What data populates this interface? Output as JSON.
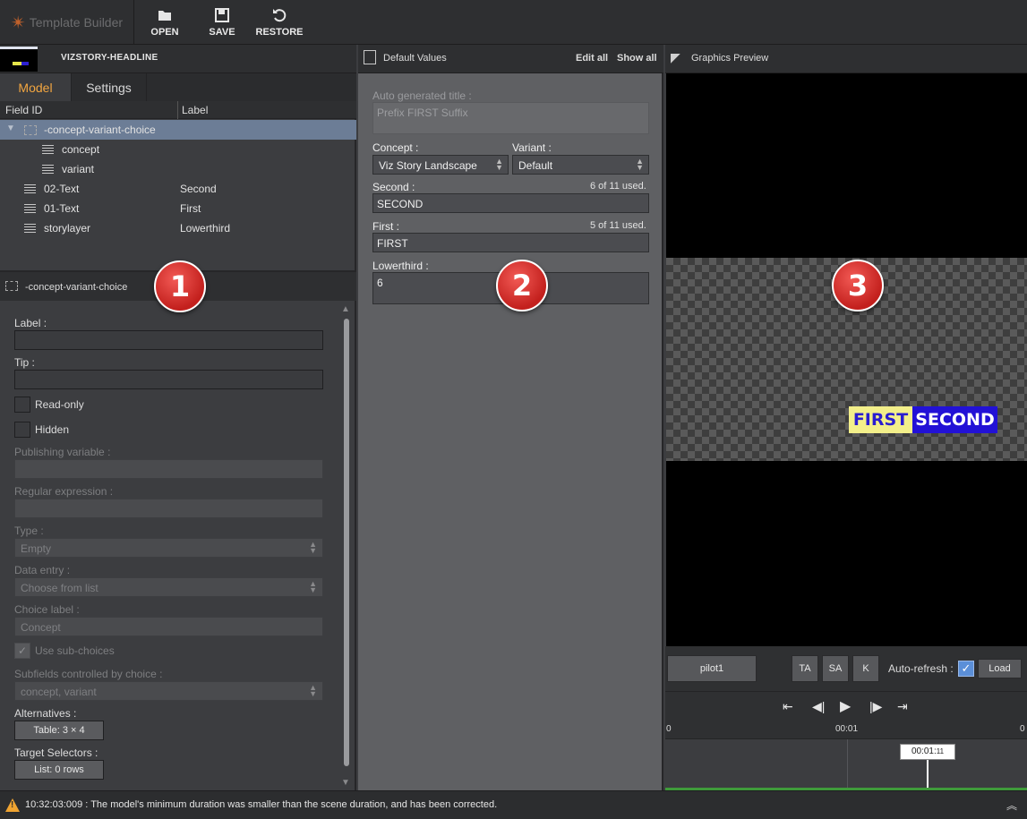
{
  "toolbar": {
    "app_name": "Template Builder",
    "buttons": {
      "open": "OPEN",
      "save": "SAVE",
      "restore": "RESTORE"
    }
  },
  "left_panel": {
    "template_name": "VIZSTORY-HEADLINE",
    "tabs": {
      "model": "Model",
      "settings": "Settings"
    },
    "columns": {
      "field_id": "Field ID",
      "label": "Label"
    },
    "tree": [
      {
        "id": "-concept-variant-choice",
        "label": ""
      },
      {
        "id": "concept",
        "label": ""
      },
      {
        "id": "variant",
        "label": ""
      },
      {
        "id": "02-Text",
        "label": "Second"
      },
      {
        "id": "01-Text",
        "label": "First"
      },
      {
        "id": "storylayer",
        "label": "Lowerthird"
      }
    ],
    "properties": {
      "title": "-concept-variant-choice",
      "label_label": "Label :",
      "tip_label": "Tip :",
      "readonly": "Read-only",
      "hidden": "Hidden",
      "publishing_label": "Publishing variable :",
      "regex_label": "Regular expression :",
      "type_label": "Type :",
      "type_value": "Empty",
      "data_entry_label": "Data entry :",
      "data_entry_value": "Choose from list",
      "choice_label_label": "Choice label :",
      "choice_label_value": "Concept",
      "use_subchoices": "Use sub-choices",
      "subfields_label": "Subfields controlled by choice :",
      "subfields_value": "concept, variant",
      "alternatives_label": "Alternatives :",
      "alternatives_button": "Table: 3 × 4",
      "target_selectors_label": "Target Selectors :",
      "target_selectors_button": "List: 0 rows"
    }
  },
  "default_values": {
    "title": "Default Values",
    "edit_all": "Edit all",
    "show_all": "Show all",
    "auto_title_label": "Auto generated title :",
    "auto_title_value": "Prefix FIRST Suffix",
    "concept_label": "Concept :",
    "concept_value": "Viz Story Landscape",
    "variant_label": "Variant :",
    "variant_value": "Default",
    "second_label": "Second :",
    "second_used": "6 of 11 used.",
    "second_value": "SECOND",
    "first_label": "First :",
    "first_used": "5 of 11 used.",
    "first_value": "FIRST",
    "lowerthird_label": "Lowerthird :",
    "lowerthird_value": "6"
  },
  "preview": {
    "title": "Graphics Preview",
    "lower_third_first": "FIRST",
    "lower_third_second": "SECOND",
    "pilot_button": "pilot1",
    "ta": "TA",
    "sa": "SA",
    "k": "K",
    "auto_refresh": "Auto-refresh :",
    "auto_refresh_checked": true,
    "load": "Load",
    "ruler_start": "0",
    "ruler_mid": "00:01",
    "ruler_end": "0",
    "playhead_time": "00:01",
    "playhead_frames": "11"
  },
  "badges": {
    "one": "1",
    "two": "2",
    "three": "3"
  },
  "status": {
    "message": "10:32:03:009 : The model's minimum duration was smaller than the scene duration, and has been corrected."
  },
  "colors": {
    "accent": "#f2a640",
    "selection": "#6c7d96",
    "badge": "#d12a26",
    "lt_yellow": "#f3ef8a",
    "lt_blue": "#2211d6"
  }
}
